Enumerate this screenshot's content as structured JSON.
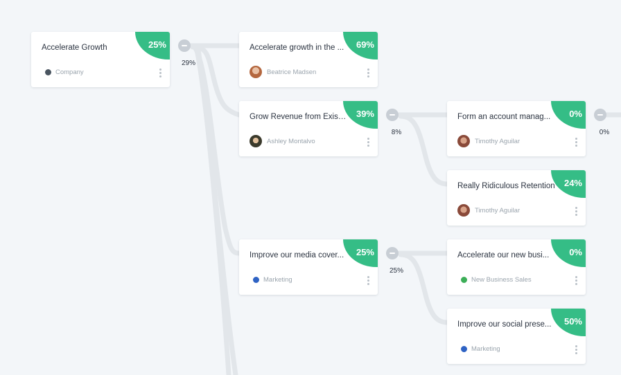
{
  "colors": {
    "accent_green": "#35bd86",
    "toggle_grey": "#c8ced5",
    "connector": "#e2e6ea"
  },
  "goals": [
    {
      "title": "Accelerate Growth",
      "progress": "25%",
      "owner": "Company",
      "owner_icon": "dot",
      "dot_color": "#4a5560"
    },
    {
      "title": "Accelerate growth in the ...",
      "progress": "69%",
      "owner": "Beatrice Madsen",
      "owner_icon": "avatar"
    },
    {
      "title": "Grow Revenue from Exist...",
      "progress": "39%",
      "owner": "Ashley Montalvo",
      "owner_icon": "avatar"
    },
    {
      "title": "Improve our media cover...",
      "progress": "25%",
      "owner": "Marketing",
      "owner_icon": "dot",
      "dot_color": "#2f63c4"
    },
    {
      "title": "Form an account manag...",
      "progress": "0%",
      "owner": "Timothy Aguilar",
      "owner_icon": "avatar"
    },
    {
      "title": "Really Ridiculous Retention",
      "progress": "24%",
      "owner": "Timothy Aguilar",
      "owner_icon": "avatar"
    },
    {
      "title": "Accelerate our new busi...",
      "progress": "0%",
      "owner": "New Business Sales",
      "owner_icon": "dot",
      "dot_color": "#3cae58"
    },
    {
      "title": "Improve our social prese...",
      "progress": "50%",
      "owner": "Marketing",
      "owner_icon": "dot",
      "dot_color": "#2f63c4"
    }
  ],
  "branch_toggles": [
    {
      "children_progress": "29%"
    },
    {
      "children_progress": "8%"
    },
    {
      "children_progress": "25%"
    },
    {
      "children_progress": "0%"
    }
  ]
}
